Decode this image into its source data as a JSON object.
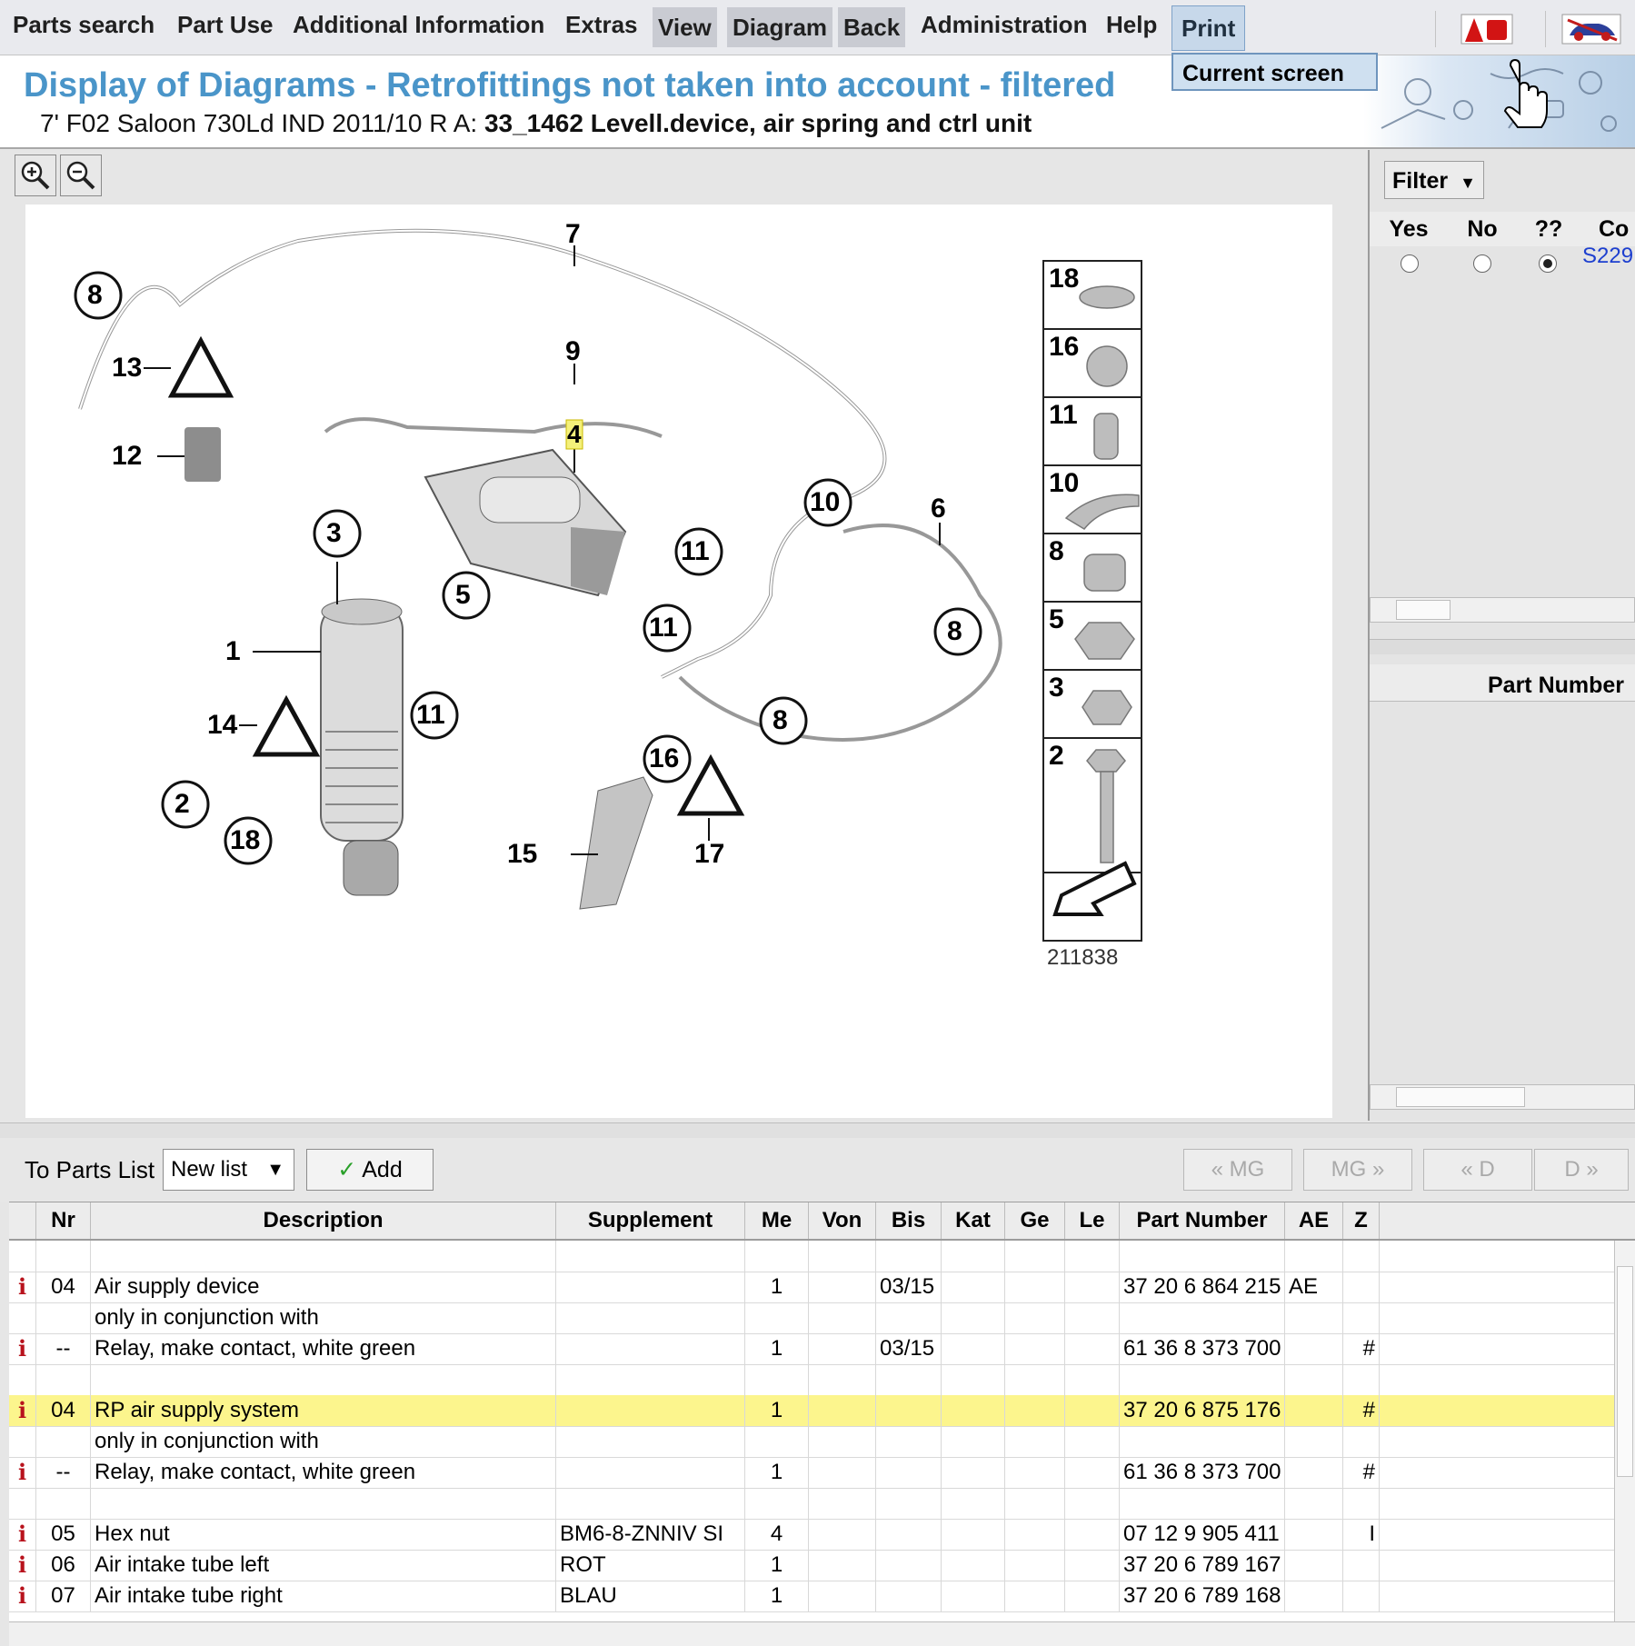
{
  "menu": {
    "items": [
      "Parts search",
      "Part Use",
      "Additional Information",
      "Extras",
      "View",
      "Diagram",
      "Back",
      "Administration",
      "Help"
    ],
    "print_label": "Print",
    "print_dropdown_item": "Current screen"
  },
  "header": {
    "title": "Display of Diagrams - Retrofittings not taken into account - filtered",
    "subtitle_prefix": "7' F02 Saloon 730Ld IND 2011/10 R A:",
    "subtitle_group": "33_1462 Levell.device, air spring and ctrl unit"
  },
  "diagram": {
    "image_number": "211838",
    "callouts": [
      "1",
      "2",
      "3",
      "4",
      "5",
      "6",
      "7",
      "8",
      "9",
      "10",
      "11",
      "12",
      "13",
      "14",
      "15",
      "16",
      "17",
      "18"
    ],
    "legend_numbers": [
      "18",
      "16",
      "11",
      "10",
      "8",
      "5",
      "3",
      "2"
    ],
    "highlighted_callout": "4"
  },
  "filter": {
    "button_label": "Filter",
    "columns": [
      "Yes",
      "No",
      "??",
      "Co"
    ],
    "selected": "??",
    "code": "S229",
    "part_number_header": "Part Number"
  },
  "bottom_toolbar": {
    "to_parts_list_label": "To Parts List",
    "list_select_value": "New list",
    "add_label": "Add",
    "nav_buttons": [
      "« MG",
      "MG »",
      "« D",
      "D »"
    ]
  },
  "table": {
    "headers": [
      "",
      "Nr",
      "Description",
      "Supplement",
      "Me",
      "Von",
      "Bis",
      "Kat",
      "Ge",
      "Le",
      "Part Number",
      "AE",
      "Z"
    ],
    "rows": [
      {
        "info": "",
        "nr": "",
        "desc": "",
        "supp": "",
        "me": "",
        "von": "",
        "bis": "",
        "part": "",
        "ae": "",
        "z": "",
        "highlight": false
      },
      {
        "info": "i",
        "nr": "04",
        "desc": "Air supply device",
        "supp": "",
        "me": "1",
        "von": "",
        "bis": "03/15",
        "part": "37 20 6 864 215",
        "ae": "AE",
        "z": "",
        "highlight": false
      },
      {
        "info": "",
        "nr": "",
        "desc": "only in conjunction with",
        "supp": "",
        "me": "",
        "von": "",
        "bis": "",
        "part": "",
        "ae": "",
        "z": "",
        "highlight": false
      },
      {
        "info": "i",
        "nr": "--",
        "desc": "Relay, make contact, white green",
        "supp": "",
        "me": "1",
        "von": "",
        "bis": "03/15",
        "part": "61 36 8 373 700",
        "ae": "",
        "z": "#",
        "highlight": false
      },
      {
        "info": "",
        "nr": "",
        "desc": "",
        "supp": "",
        "me": "",
        "von": "",
        "bis": "",
        "part": "",
        "ae": "",
        "z": "",
        "highlight": false
      },
      {
        "info": "i",
        "nr": "04",
        "desc": "RP air supply system",
        "supp": "",
        "me": "1",
        "von": "",
        "bis": "",
        "part": "37 20 6 875 176",
        "ae": "",
        "z": "#",
        "highlight": true
      },
      {
        "info": "",
        "nr": "",
        "desc": "only in conjunction with",
        "supp": "",
        "me": "",
        "von": "",
        "bis": "",
        "part": "",
        "ae": "",
        "z": "",
        "highlight": false
      },
      {
        "info": "i",
        "nr": "--",
        "desc": "Relay, make contact, white green",
        "supp": "",
        "me": "1",
        "von": "",
        "bis": "",
        "part": "61 36 8 373 700",
        "ae": "",
        "z": "#",
        "highlight": false
      },
      {
        "info": "",
        "nr": "",
        "desc": "",
        "supp": "",
        "me": "",
        "von": "",
        "bis": "",
        "part": "",
        "ae": "",
        "z": "",
        "highlight": false
      },
      {
        "info": "i",
        "nr": "05",
        "desc": "Hex nut",
        "supp": "BM6-8-ZNNIV SI",
        "me": "4",
        "von": "",
        "bis": "",
        "part": "07 12 9 905 411",
        "ae": "",
        "z": "I",
        "highlight": false
      },
      {
        "info": "i",
        "nr": "06",
        "desc": "Air intake tube left",
        "supp": "ROT",
        "me": "1",
        "von": "",
        "bis": "",
        "part": "37 20 6 789 167",
        "ae": "",
        "z": "",
        "highlight": false
      },
      {
        "info": "i",
        "nr": "07",
        "desc": "Air intake tube right",
        "supp": "BLAU",
        "me": "1",
        "von": "",
        "bis": "",
        "part": "37 20 6 789 168",
        "ae": "",
        "z": "",
        "highlight": false
      }
    ]
  }
}
